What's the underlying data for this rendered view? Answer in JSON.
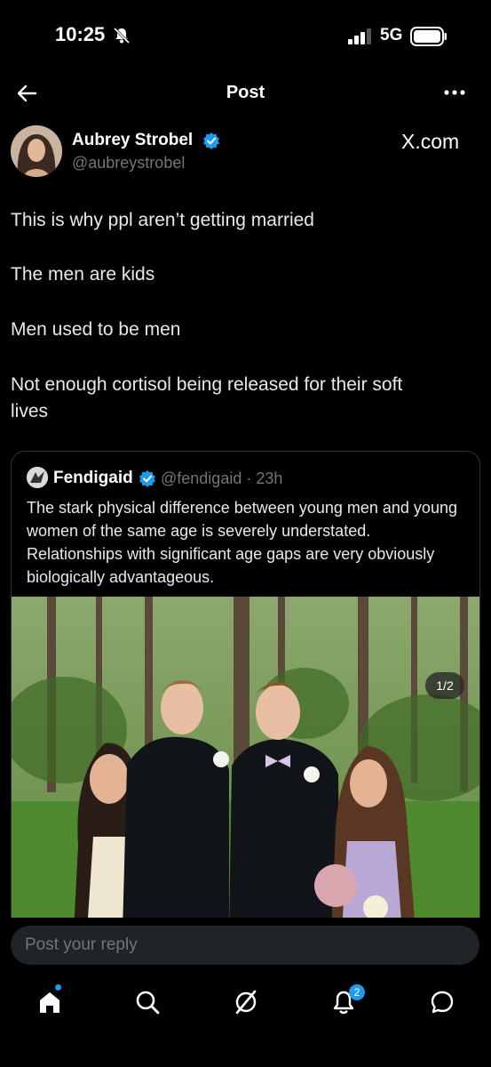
{
  "status_bar": {
    "time": "10:25",
    "network": "5G"
  },
  "header": {
    "title": "Post"
  },
  "post": {
    "author_name": "Aubrey Strobel",
    "author_handle": "@aubreystrobel",
    "source": "X.com",
    "lines": [
      "This is why ppl aren’t getting married",
      "The men are kids",
      "Men used to be men",
      "Not enough cortisol being released for their soft",
      "lives"
    ]
  },
  "quote": {
    "author_name": "Fendigaid",
    "handle_time": "@fendigaid · 23h",
    "text": "The stark physical difference between young men and young women of the same age is severely understated. Relationships with significant age gaps are very obviously biologically advantageous.",
    "media_counter": "1/2"
  },
  "reply": {
    "placeholder": "Post your reply"
  },
  "nav": {
    "notifications_badge": "2"
  },
  "colors": {
    "accent": "#1d9bf0",
    "background": "#000000",
    "secondary_text": "#71767b"
  }
}
